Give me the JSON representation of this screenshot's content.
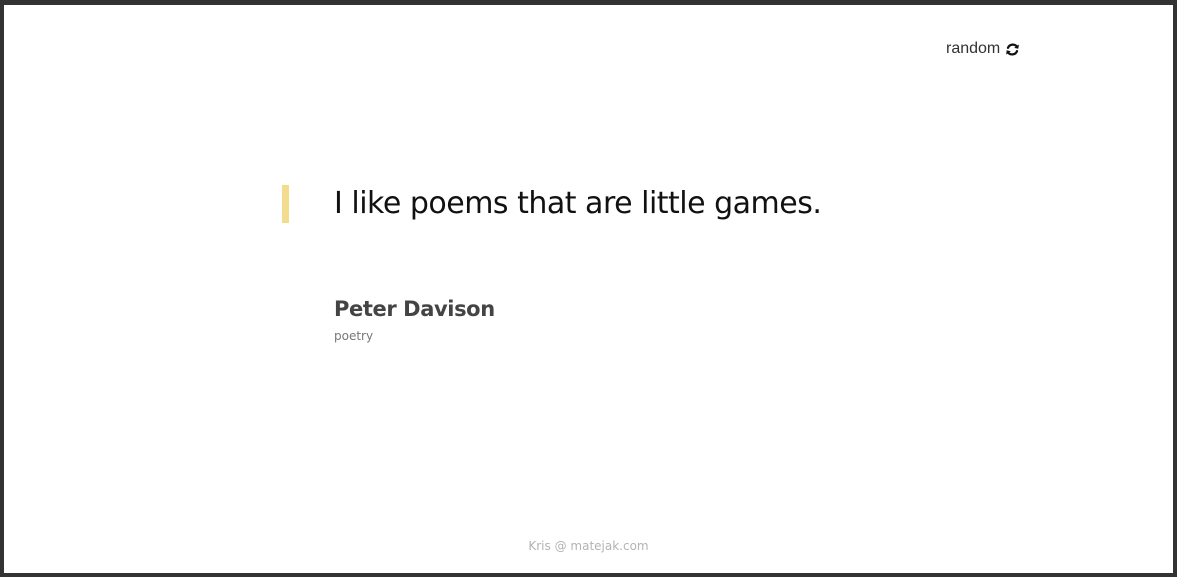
{
  "header": {
    "random_label": "random",
    "random_icon": "refresh-icon"
  },
  "quote": {
    "text": "I like poems that are little games.",
    "accent_color": "#f4dc8e"
  },
  "author": {
    "name": "Peter Davison",
    "tag": "poetry"
  },
  "footer": {
    "prefix": "Kris @ ",
    "link_text": "matejak.com"
  }
}
